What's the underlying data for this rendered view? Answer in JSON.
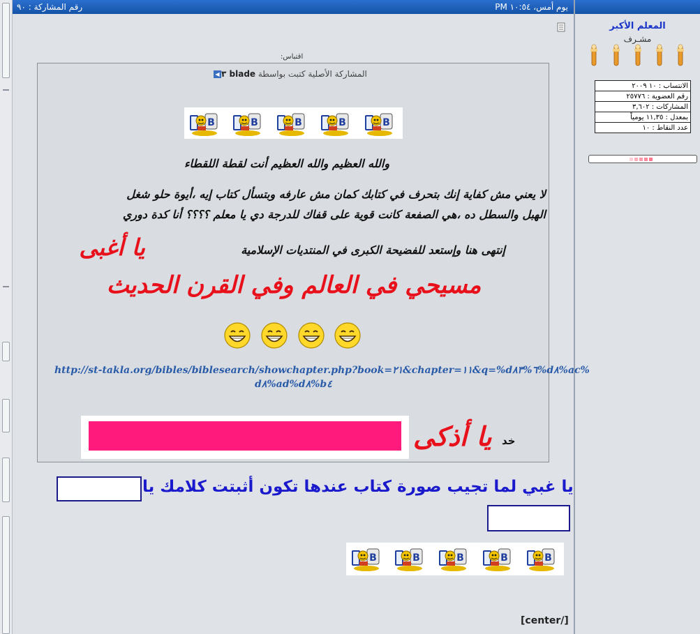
{
  "header": {
    "post_number": "رقم المشاركة : ٩٠",
    "post_date": "يوم أمس، ١٠:٥٤ PM"
  },
  "user": {
    "name": "المعلم الأكبر",
    "title": "مشـرف",
    "stats": [
      "الانتساب : ١٠ ٢٠٠٩",
      "رقم العضوية : ٢٥٧٧٦",
      "المشاركات : ٣,٦٠٢",
      "بمعدل : ١١,٣٥ يومياً",
      "عدد النقاط : ١٠"
    ],
    "colors": {
      "name": "#1a35c9",
      "rep_dots": "#ff9aaa"
    }
  },
  "quote": {
    "label": "اقتباس:",
    "author_prefix": "المشاركة الأصلية كتبت بواسطة ",
    "author_name": "blade ٣",
    "view_post_icon": "arrow-icon",
    "line1": "والله العظيم والله العظيم أنت لقطة اللقطاء",
    "line2a": "لا يعني مش كفاية إنك بتحرف في كتابك كمان مش عارفه وبتسأل كتاب إيه ،أيوة حلو شغل",
    "line2b": "الهبل والسطل ده ،هي الصفعة كانت قوية على قفاك للدرجة دي يا معلم ؟؟؟؟ أنا كدة دوري",
    "line3": "إنتهى هنا وإستعد للفضيحة الكبرى في المنتديات الإسلامية",
    "line3_red": "يا أغبى",
    "line4": "مسيحي في العالم وفي القرن الحديث",
    "link_line1": "http://st-takla.org/bibles/biblesearch/showchapter.php?book=٢١&chapter=١١&q=%d٦%٨٣%d٨%ac%",
    "link_line2": "d٨%ad%d٨%b٤",
    "khod": "خد",
    "ya_adhka": "يا أذكى",
    "colors": {
      "emphasis_red": "#e8101a",
      "link_blue": "#2a5ba8",
      "pink_bar": "#ff1a7c"
    }
  },
  "reply": {
    "text": "يا غبي لما تجيب صورة كتاب عندها تكون أثبتت كلامك يا",
    "end_tag": "[center/]",
    "color": "#1a1acc"
  }
}
